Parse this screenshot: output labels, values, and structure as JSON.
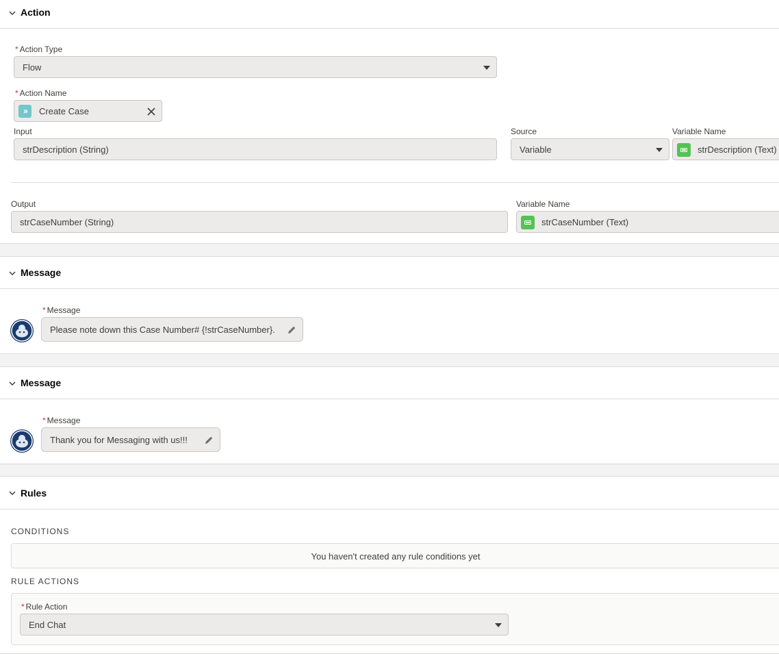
{
  "action": {
    "title": "Action",
    "action_type_label": "Action Type",
    "action_type_value": "Flow",
    "action_name_label": "Action Name",
    "action_name_value": "Create Case",
    "input_label": "Input",
    "input_value": "strDescription (String)",
    "source_label": "Source",
    "source_value": "Variable",
    "input_var_label": "Variable Name",
    "input_var_value": "strDescription (Text)",
    "output_label": "Output",
    "output_value": "strCaseNumber (String)",
    "output_var_label": "Variable Name",
    "output_var_value": "strCaseNumber (Text)"
  },
  "message1": {
    "title": "Message",
    "label": "Message",
    "text": "Please note down this Case Number# {!strCaseNumber}."
  },
  "message2": {
    "title": "Message",
    "label": "Message",
    "text": "Thank you for Messaging with us!!!"
  },
  "rules": {
    "title": "Rules",
    "conditions_label": "CONDITIONS",
    "conditions_empty": "You haven't created any rule conditions yet",
    "rule_actions_label": "RULE ACTIONS",
    "rule_action_label": "Rule Action",
    "rule_action_value": "End Chat"
  },
  "required_marker": "*",
  "icons": [
    "chevron-down-icon",
    "flow-icon",
    "close-icon",
    "variable-icon",
    "bot-avatar-icon",
    "pencil-icon",
    "dropdown-caret-icon"
  ]
}
